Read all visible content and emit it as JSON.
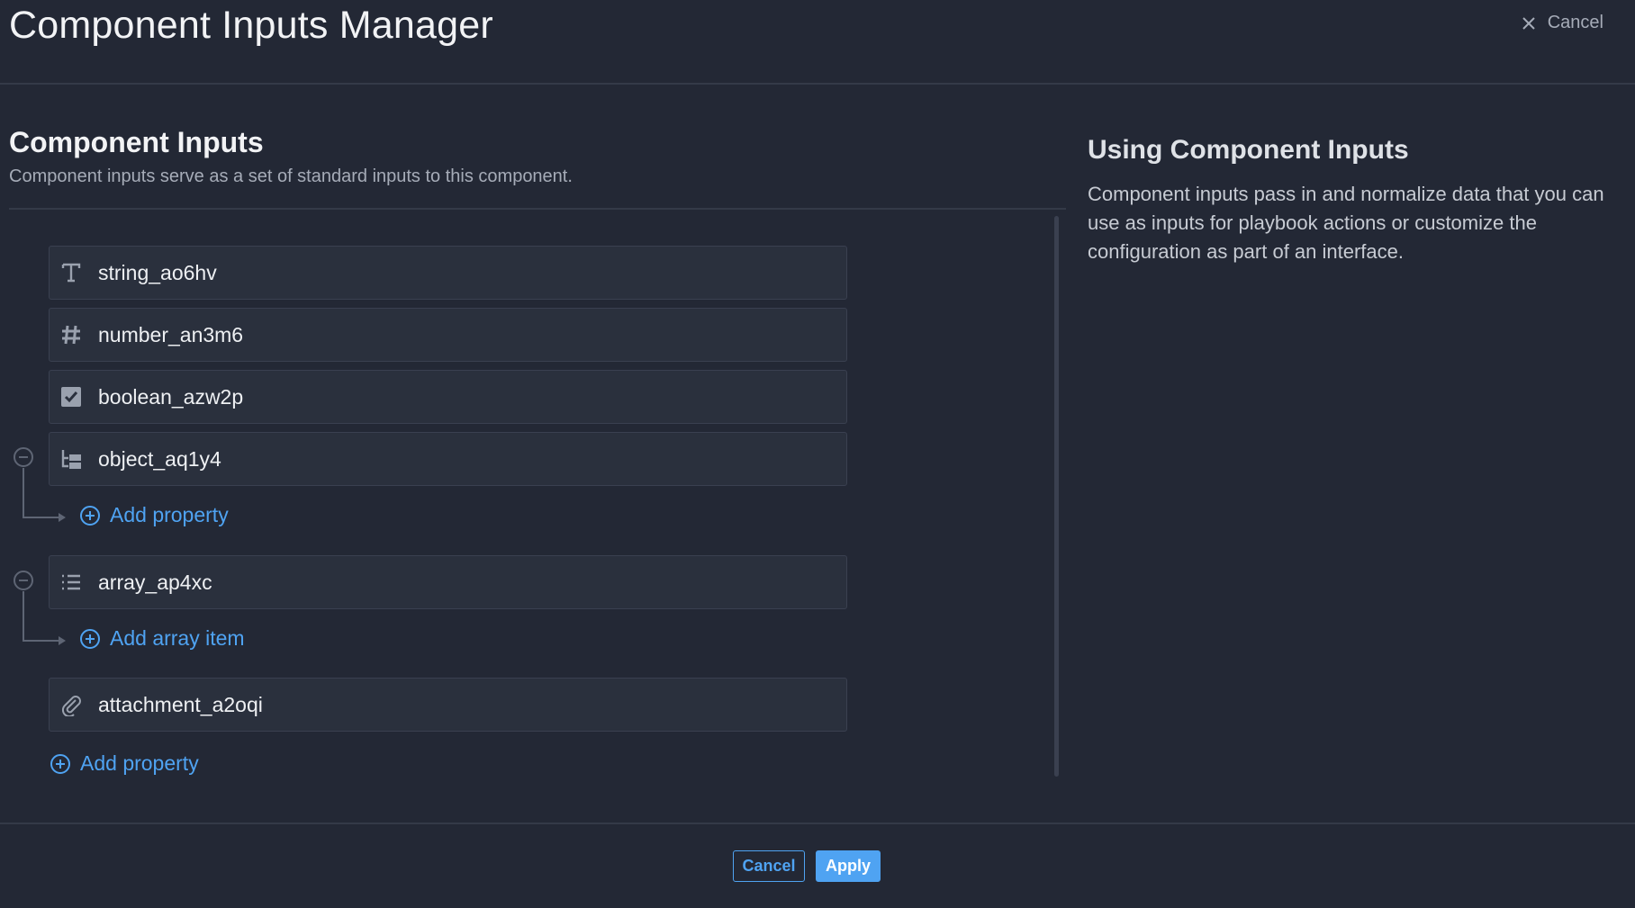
{
  "header": {
    "title": "Component Inputs Manager",
    "cancel_label": "Cancel"
  },
  "section": {
    "title": "Component Inputs",
    "subtitle": "Component inputs serve as a set of standard inputs to this component."
  },
  "inputs": [
    {
      "type": "string",
      "icon": "text-type-icon",
      "label": "string_ao6hv"
    },
    {
      "type": "number",
      "icon": "hash-icon",
      "label": "number_an3m6"
    },
    {
      "type": "boolean",
      "icon": "checkbox-icon",
      "label": "boolean_azw2p"
    },
    {
      "type": "object",
      "icon": "object-tree-icon",
      "label": "object_aq1y4",
      "child_link": "Add property"
    },
    {
      "type": "array",
      "icon": "list-icon",
      "label": "array_ap4xc",
      "child_link": "Add array item"
    },
    {
      "type": "attachment",
      "icon": "paperclip-icon",
      "label": "attachment_a2oqi"
    }
  ],
  "add_property_label": "Add property",
  "help": {
    "title": "Using Component Inputs",
    "body": "Component inputs pass in and normalize data that you can use as inputs for playbook actions or customize the configuration as part of an interface."
  },
  "footer": {
    "cancel_label": "Cancel",
    "apply_label": "Apply"
  },
  "colors": {
    "background": "#232835",
    "accent": "#4fa3f2",
    "row": "#2a303d"
  }
}
